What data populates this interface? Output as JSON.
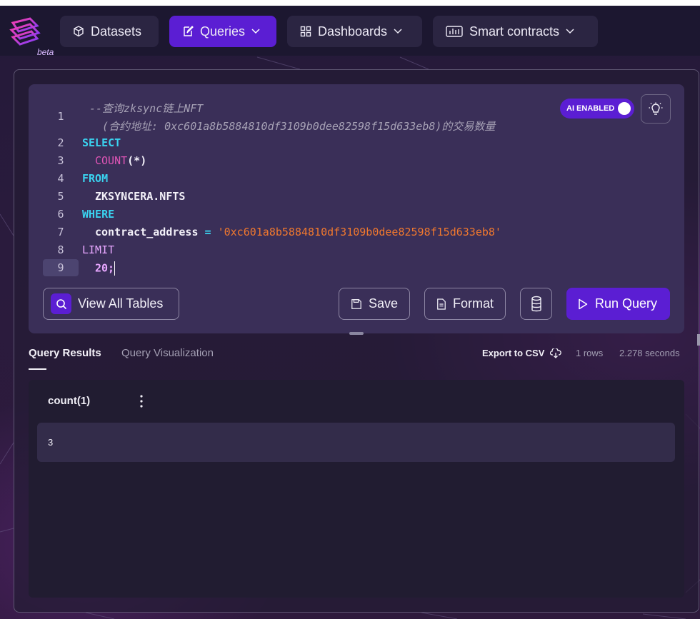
{
  "nav": {
    "logo_badge": "beta",
    "items": [
      {
        "label": "Datasets",
        "icon": "cube-icon"
      },
      {
        "label": "Queries",
        "icon": "edit-icon",
        "active": true,
        "dropdown": true
      },
      {
        "label": "Dashboards",
        "icon": "grid-icon",
        "dropdown": true
      },
      {
        "label": "Smart contracts",
        "icon": "bar-chart-icon",
        "dropdown": true
      }
    ]
  },
  "editor": {
    "line_numbers": [
      "1",
      "2",
      "3",
      "4",
      "5",
      "6",
      "7",
      "8",
      "9"
    ],
    "comment_line1": "--查询zksync链上NFT",
    "comment_line2": "(合约地址: 0xc601a8b5884810df3109b0dee82598f15d633eb8)的交易数量",
    "select_kw": "SELECT",
    "count_fn": "COUNT",
    "count_args": "(*)",
    "from_kw": "FROM",
    "table_name": "ZKSYNCERA.NFTS",
    "where_kw": "WHERE",
    "where_col": "contract_address",
    "where_op": "=",
    "where_value": "'0xc601a8b5884810df3109b0dee82598f15d633eb8'",
    "limit_kw": "LIMIT",
    "limit_value": "20;",
    "ai_toggle_label": "AI ENABLED",
    "ai_enabled": true
  },
  "actions": {
    "view_tables": "View All Tables",
    "save": "Save",
    "format": "Format",
    "run": "Run Query"
  },
  "results_bar": {
    "tabs": [
      "Query Results",
      "Query Visualization"
    ],
    "export": "Export to CSV",
    "rows": "1 rows",
    "duration": "2.278 seconds"
  },
  "table": {
    "columns": [
      "count(1)"
    ],
    "rows": [
      [
        "3"
      ]
    ]
  },
  "colors": {
    "accent": "#5b1ed3",
    "keyword": "#3ad3f0",
    "function": "#e055b6",
    "string": "#f0782e",
    "number": "#e8a7ff"
  }
}
